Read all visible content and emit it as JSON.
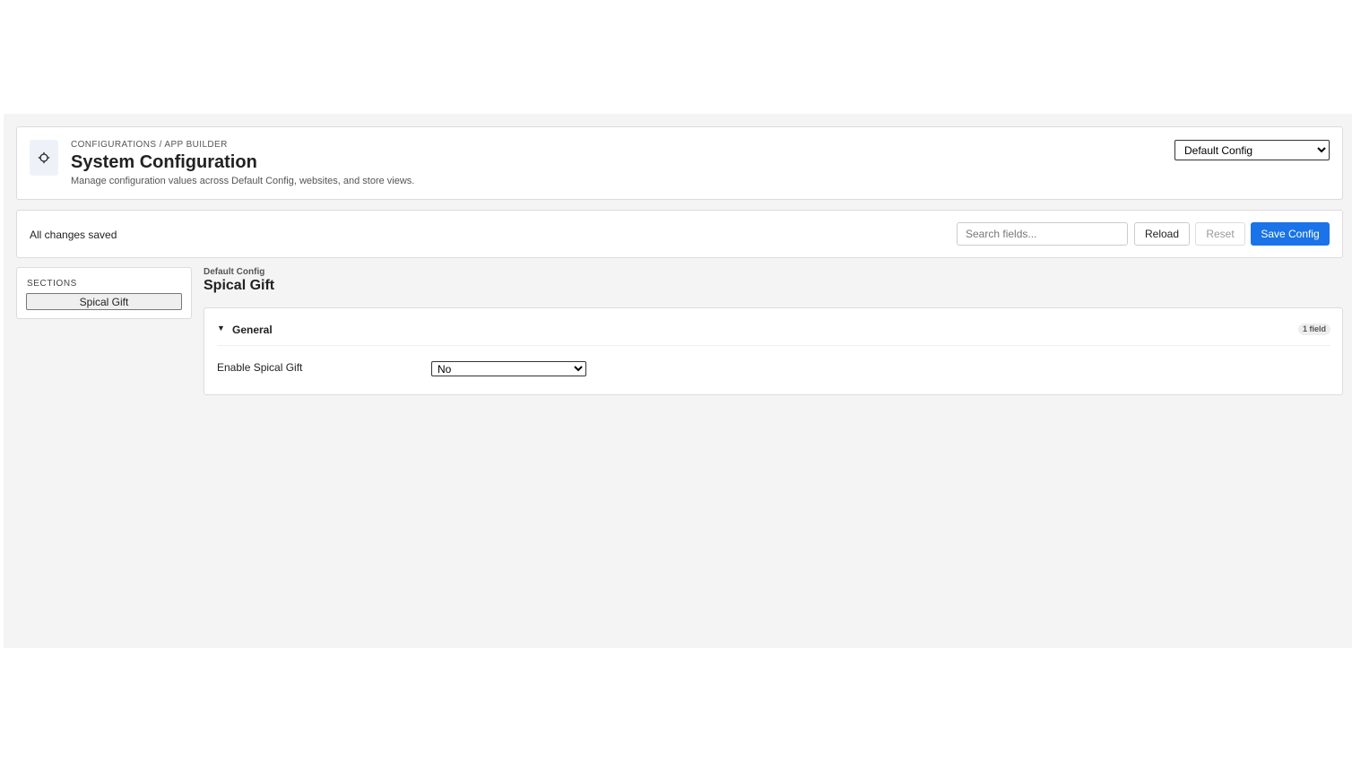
{
  "header": {
    "breadcrumb": "CONFIGURATIONS / APP BUILDER",
    "title": "System Configuration",
    "subtitle": "Manage configuration values across Default Config, websites, and store views.",
    "icon": "gear-icon",
    "scope_selected": "Default Config"
  },
  "toolbar": {
    "status": "All changes saved",
    "search_placeholder": "Search fields...",
    "reload_label": "Reload",
    "reset_label": "Reset",
    "save_label": "Save Config"
  },
  "sidebar": {
    "heading": "SECTIONS",
    "items": [
      {
        "label": "Spical Gift"
      }
    ]
  },
  "main": {
    "scope": "Default Config",
    "title": "Spical Gift",
    "groups": [
      {
        "toggle": "▼",
        "title": "General",
        "field_count": "1 field",
        "fields": [
          {
            "label": "Enable Spical Gift",
            "value": "No"
          }
        ]
      }
    ]
  },
  "colors": {
    "accent": "#1a73e8",
    "background": "#f4f4f4"
  }
}
